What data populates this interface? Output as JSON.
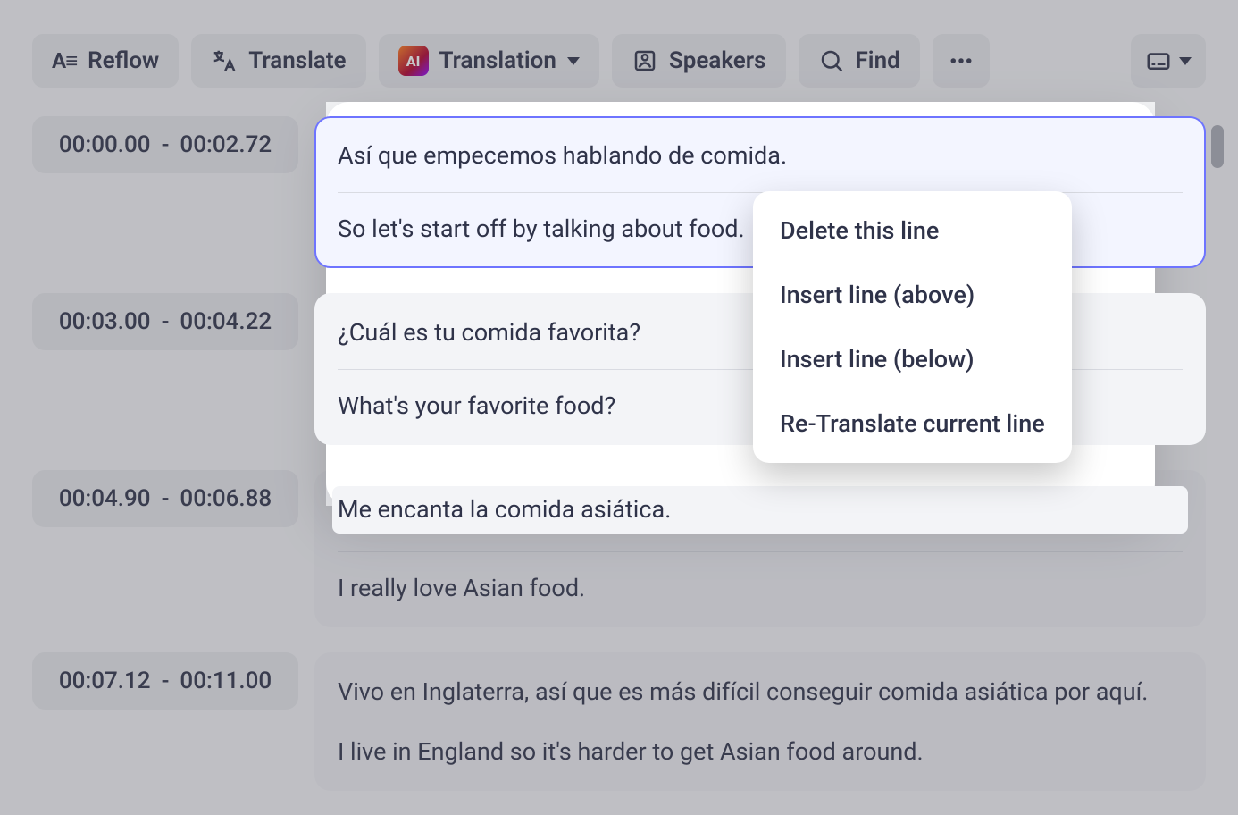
{
  "toolbar": {
    "reflow": "Reflow",
    "translate": "Translate",
    "translation": "Translation",
    "speakers": "Speakers",
    "find": "Find",
    "ai_badge": "AI"
  },
  "rows": [
    {
      "start": "00:00.00",
      "end": "00:02.72",
      "source": "Así que empecemos hablando de comida.",
      "target": "So let's start off by talking about food."
    },
    {
      "start": "00:03.00",
      "end": "00:04.22",
      "source": "¿Cuál es tu comida favorita?",
      "target": "What's your favorite food?"
    },
    {
      "start": "00:04.90",
      "end": "00:06.88",
      "source": "Me encanta la comida asiática.",
      "target": "I really love Asian food."
    },
    {
      "start": "00:07.12",
      "end": "00:11.00",
      "source": "Vivo en Inglaterra, así que es más difícil conseguir comida asiática por aquí.",
      "target": "I live in England so it's harder to get Asian food around."
    }
  ],
  "context_menu": {
    "delete": "Delete this line",
    "insert_above": "Insert line (above)",
    "insert_below": "Insert line (below)",
    "retranslate": "Re-Translate current line"
  },
  "icons": {
    "reflow": "reflow-icon",
    "translate": "translate-icon",
    "speakers": "speakers-icon",
    "find": "search-icon",
    "more": "ellipsis-icon",
    "cc": "caption-icon",
    "dropdown": "chevron-down-icon"
  }
}
